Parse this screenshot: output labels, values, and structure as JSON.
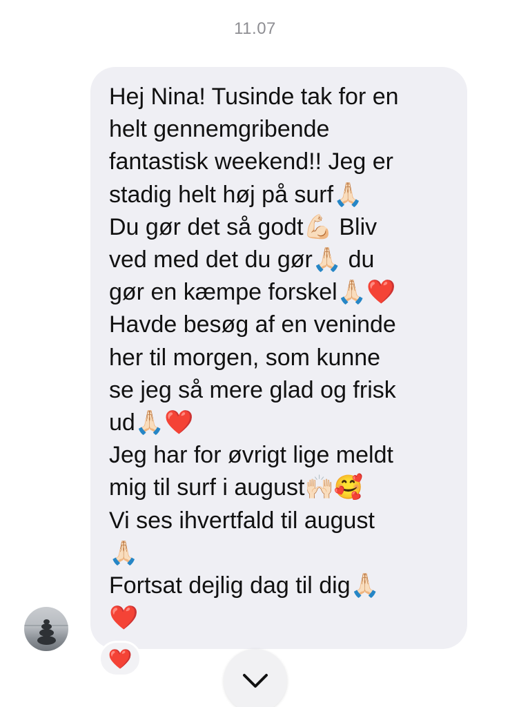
{
  "header": {
    "timestamp": "11.07"
  },
  "message": {
    "lines": [
      "Hej Nina! Tusinde tak for en",
      "helt gennemgribende",
      "fantastisk weekend!! Jeg er",
      "stadig helt høj på surf🙏🏻",
      "Du gør det så godt💪🏻 Bliv",
      "ved med det du gør🙏🏻 du",
      "gør en kæmpe forskel🙏🏻❤️",
      "Havde besøg af en veninde",
      "her til morgen, som kunne",
      "se jeg så mere glad og frisk",
      "ud🙏🏻❤️",
      "Jeg har for øvrigt lige meldt",
      "mig til surf i august🙌🏻🥰",
      "Vi ses ihvertfald til august",
      "🙏🏻",
      "Fortsat dejlig dag til dig🙏🏻",
      "❤️"
    ]
  },
  "reaction": {
    "emoji": "❤️",
    "icon": "heart-icon",
    "color": "#e0242b"
  },
  "scroll_button": {
    "icon": "chevron-down-icon"
  },
  "colors": {
    "bubble": "#efeff4",
    "timestamp": "#8e8e93",
    "text": "#111111"
  }
}
